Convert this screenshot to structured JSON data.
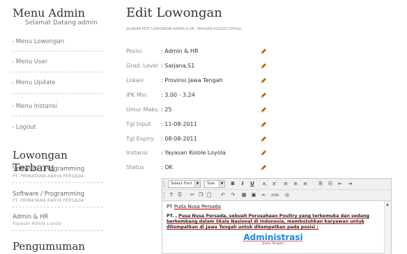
{
  "sidebar": {
    "title": "Menu Admin",
    "subtitle": "Selamat Datang admin",
    "menu": [
      {
        "label": "- Menu Lowongan"
      },
      {
        "label": "- Menu User"
      },
      {
        "label": "- Menu Update"
      },
      {
        "label": "- Menu Instansi"
      },
      {
        "label": "- Logout"
      }
    ],
    "vacancies_heading": "Lowongan Terbaru",
    "vacancies": [
      {
        "title": "Software / Programming",
        "company": "PT. PRIMATAMA KARYA PERSADA"
      },
      {
        "title": "Software / Programming",
        "company": "PT. PRIMATAMA KARYA PERSADA"
      },
      {
        "title": "Admin & HR",
        "company": "Yayasan Kolole Loyola"
      }
    ],
    "announcements_heading": "Pengumuman"
  },
  "main": {
    "title": "Edit Lowongan",
    "subtitle": "SILAKAN EDIT LOWONGAN ADMIN & HR, YAYASAN KOLOLE LOYOLA",
    "fields": [
      {
        "label": "Posisi",
        "value": ": Admin & HR",
        "icon": "pencil-icon"
      },
      {
        "label": "Grad. Level",
        "value": ": Sarjana,S1",
        "icon": "pencil-icon"
      },
      {
        "label": "Lokasi",
        "value": ": Provinsi Jawa Tengah",
        "icon": "pencil-icon"
      },
      {
        "label": "IPK Min.",
        "value": ": 3.00 - 3.24",
        "icon": "pencil-icon"
      },
      {
        "label": "Umur Maks.",
        "value": ": 25",
        "icon": "pencil-icon"
      },
      {
        "label": "Tgl Input",
        "value": ": 11-08-2011",
        "icon": "pencil-icon"
      },
      {
        "label": "Tgl Expiry",
        "value": ": 08-08-2011",
        "icon": "pencil-icon"
      },
      {
        "label": "Instansi",
        "value": ": Yayasan Kolole Loyola",
        "icon": "pencil-icon"
      },
      {
        "label": "Status",
        "value": ": OK",
        "icon": "pencil-icon"
      }
    ]
  },
  "editor": {
    "font_select": "Select Font",
    "size_select": "Size",
    "bold": "B",
    "italic": "I",
    "underline": "U",
    "subscript": "x,",
    "superscript": "x'",
    "html_btn": "HTML",
    "content": {
      "line1_prefix": "PT ",
      "line1_underlined": "Puda Nusa Persada",
      "para_prefix": "PT. , ",
      "para_underlined": "Pusa Nusa Persada, sebuah Perusahaan Poultry yang terkemuka dan sedang berkembang dalam Skala Nasional di Indonesia, membutuhkan karyawan untuk ditempatkan di Jawa Tengah untuk ditempatkan pada posisi :",
      "heading": "Administrasi",
      "heading_sub": "(Jawa Tengah)"
    }
  },
  "colors": {
    "accent_heading": "#1e88e5",
    "pencil": "#c0620a",
    "spellcheck": "#cc0000"
  }
}
